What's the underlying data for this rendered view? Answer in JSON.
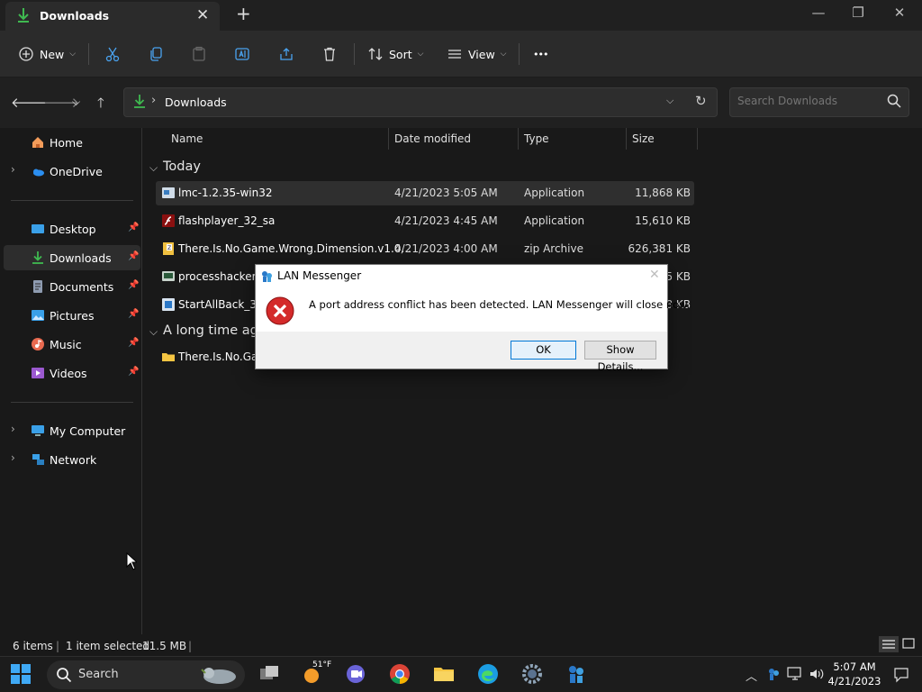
{
  "window": {
    "tab_title": "Downloads",
    "new_tab": "+",
    "controls": {
      "minimize": "—",
      "maximize": "❐",
      "close": "✕"
    }
  },
  "toolbar": {
    "new_label": "New",
    "sort_label": "Sort",
    "view_label": "View",
    "more_label": "•••"
  },
  "address": {
    "crumb": "Downloads",
    "search_placeholder": "Search Downloads"
  },
  "sidebar": {
    "quick": [
      {
        "label": "Home",
        "icon": "home-icon"
      },
      {
        "label": "OneDrive",
        "icon": "cloud-icon"
      }
    ],
    "pinned": [
      {
        "label": "Desktop",
        "icon": "desktop-icon"
      },
      {
        "label": "Downloads",
        "icon": "download-icon"
      },
      {
        "label": "Documents",
        "icon": "document-icon"
      },
      {
        "label": "Pictures",
        "icon": "pictures-icon"
      },
      {
        "label": "Music",
        "icon": "music-icon"
      },
      {
        "label": "Videos",
        "icon": "video-icon"
      }
    ],
    "devices": [
      {
        "label": "My Computer",
        "icon": "computer-icon"
      },
      {
        "label": "Network",
        "icon": "network-icon"
      }
    ]
  },
  "columns": {
    "name": "Name",
    "date": "Date modified",
    "type": "Type",
    "size": "Size"
  },
  "groups": [
    {
      "label": "Today",
      "files": [
        {
          "name": "lmc-1.2.35-win32",
          "date": "4/21/2023 5:05 AM",
          "type": "Application",
          "size": "11,868 KB"
        },
        {
          "name": "flashplayer_32_sa",
          "date": "4/21/2023 4:45 AM",
          "type": "Application",
          "size": "15,610 KB"
        },
        {
          "name": "There.Is.No.Game.Wrong.Dimension.v1.0...",
          "date": "4/21/2023 4:00 AM",
          "type": "zip Archive",
          "size": "626,381 KB"
        },
        {
          "name": "processhacker-2",
          "date": "",
          "type": "",
          "size": "5 KB"
        },
        {
          "name": "StartAllBack_3.6.",
          "date": "",
          "type": "",
          "size": "58 KB"
        }
      ]
    },
    {
      "label": "A long time ago",
      "files": [
        {
          "name": "There.Is.No.Gam",
          "date": "",
          "type": "",
          "size": ""
        }
      ]
    }
  ],
  "status": {
    "count": "6 items",
    "selection": "1 item selected",
    "selection_size": "11.5 MB"
  },
  "dialog": {
    "title": "LAN Messenger",
    "message": "A port address conflict has been detected. LAN Messenger will close now.",
    "ok_label": "OK",
    "details_label": "Show Details..."
  },
  "taskbar": {
    "search_label": "Search",
    "weather": "51°F",
    "time": "5:07 AM",
    "date": "4/21/2023"
  }
}
